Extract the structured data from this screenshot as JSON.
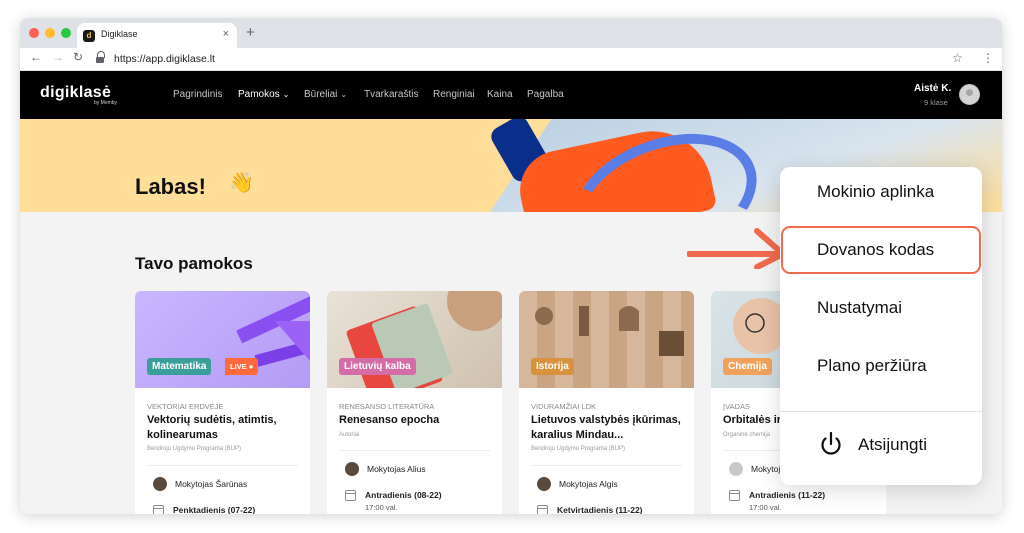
{
  "browser": {
    "tab_title": "Digiklase",
    "tab_close": "×",
    "new_tab": "+",
    "url": "https://app.digiklase.lt",
    "nav_back": "←",
    "nav_forward": "→",
    "nav_reload": "↻",
    "bookmark": "☆",
    "menu": "⋮"
  },
  "app": {
    "logo": "digiklasė",
    "logo_sub": "by Memby",
    "nav": [
      {
        "label": "Pagrindinis"
      },
      {
        "label": "Pamokos"
      },
      {
        "label": "Būreliai"
      },
      {
        "label": "Tvarkaraštis"
      },
      {
        "label": "Renginiai"
      },
      {
        "label": "Kaina"
      },
      {
        "label": "Pagalba"
      }
    ],
    "chevron": "⌄",
    "user": {
      "name": "Aistė K.",
      "class": "9 klasė"
    }
  },
  "hero": {
    "greeting": "Labas!",
    "emoji": "👋"
  },
  "lessons": {
    "title": "Tavo pamokos",
    "cards": [
      {
        "subject": "Matematika",
        "live": "LIVE ●",
        "subject_color": "#3a9e9a",
        "topic": "Vektoriai erdvėje",
        "title": "Vektorių sudėtis, atimtis, kolinearumas",
        "program": "Bendrojo Ugdymo Programa (BUP)",
        "teacher": "Mokytojas Šarūnas",
        "day": "Penktadienis (07-22)",
        "time": ""
      },
      {
        "subject": "Lietuvių kalba",
        "subject_color": "#d46ca7",
        "topic": "Renesanso literatūra",
        "title": "Renesanso epocha",
        "program": "Autoriai",
        "teacher": "Mokytojas Alius",
        "day": "Antradienis (08-22)",
        "time": "17:00 val."
      },
      {
        "subject": "Istorija",
        "subject_color": "#d8923e",
        "topic": "Viduramžiai LDK",
        "title": "Lietuvos valstybės įkūrimas, karalius Mindau...",
        "program": "Bendrojo Ugdymo Programa (BUP)",
        "teacher": "Mokytojas Algis",
        "day": "Ketvirtadienis (11-22)",
        "time": ""
      },
      {
        "subject": "Chemija",
        "subject_color": "#f0a25c",
        "topic": "Įvadas",
        "title": "Orbitalės ir",
        "program": "Organinė chemija",
        "teacher": "Mokytojas Martynas",
        "day": "Antradienis (11-22)",
        "time": "17:00 val."
      }
    ]
  },
  "dropdown": {
    "items": [
      {
        "label": "Mokinio aplinka"
      },
      {
        "label": "Dovanos kodas"
      },
      {
        "label": "Nustatymai"
      },
      {
        "label": "Plano peržiūra"
      }
    ],
    "logout": "Atsijungti",
    "highlight_color": "#f06a4d"
  }
}
